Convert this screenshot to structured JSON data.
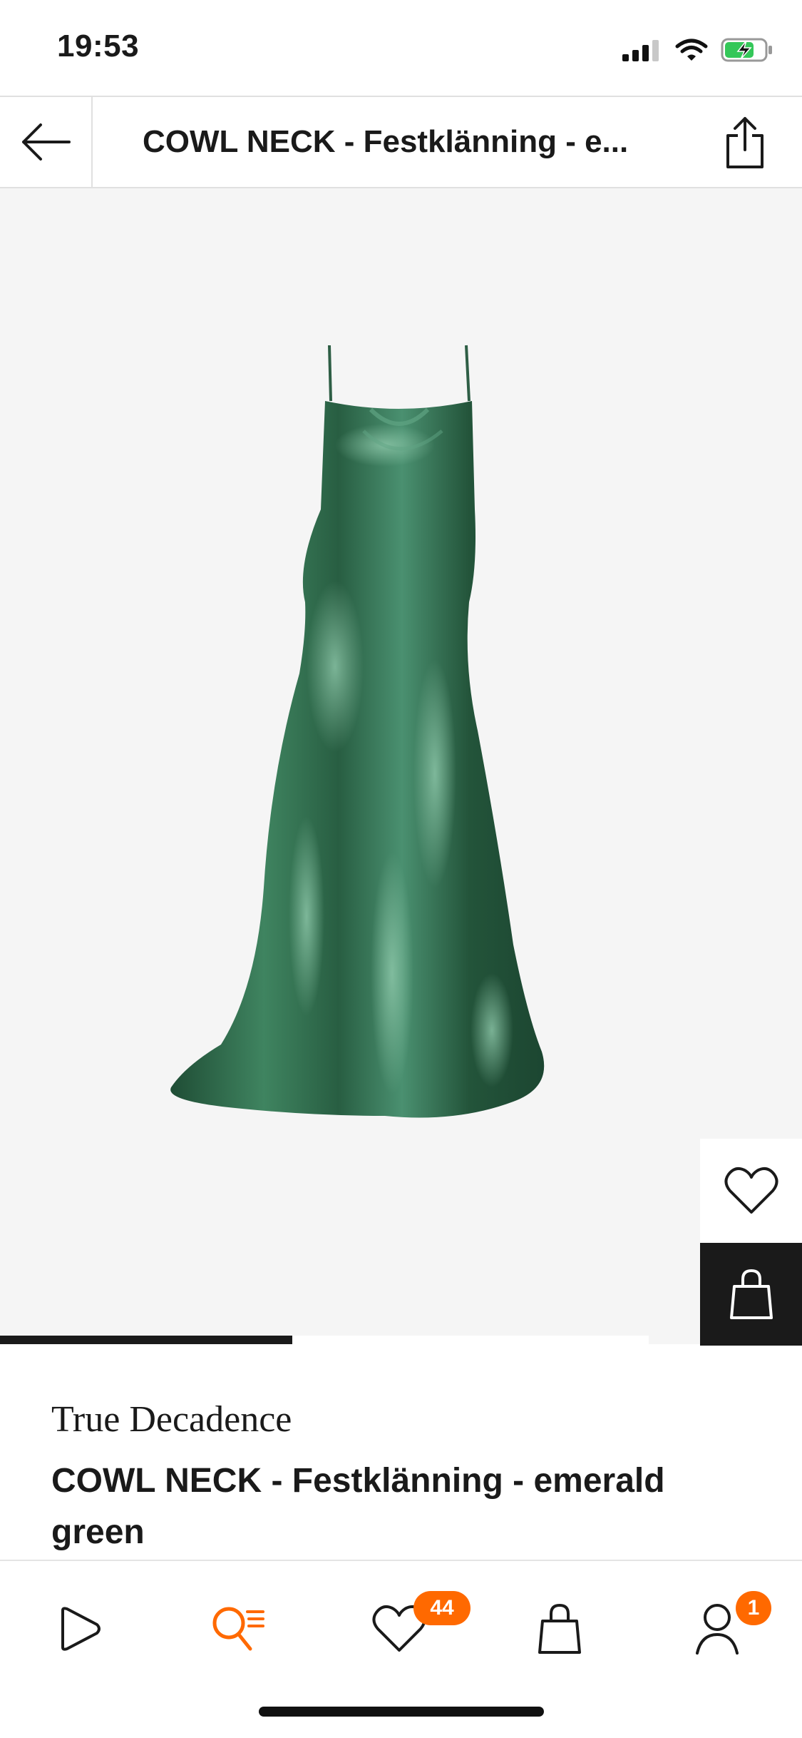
{
  "status_bar": {
    "time": "19:53",
    "icons": [
      "signal-icon",
      "wifi-icon",
      "battery-charging-icon"
    ]
  },
  "header": {
    "title": "COWL NECK - Festklänning - e...",
    "back_icon": "arrow-left-icon",
    "share_icon": "share-icon"
  },
  "gallery": {
    "image": "green-satin-dress",
    "background": "#f5f5f5",
    "progress": 0.5,
    "wishlist_icon": "heart-icon",
    "bag_icon": "bag-icon"
  },
  "product": {
    "brand": "True Decadence",
    "name": "COWL NECK - Festklänning - emerald green"
  },
  "bottom_nav": {
    "items": [
      {
        "icon": "play-icon",
        "active": false
      },
      {
        "icon": "search-list-icon",
        "active": true
      },
      {
        "icon": "heart-icon",
        "badge": "44"
      },
      {
        "icon": "bag-icon"
      },
      {
        "icon": "profile-icon",
        "badge": "1"
      }
    ]
  },
  "colors": {
    "accent": "#ff6900",
    "dark": "#1a1a1a",
    "dress": "#2f6b4a"
  }
}
